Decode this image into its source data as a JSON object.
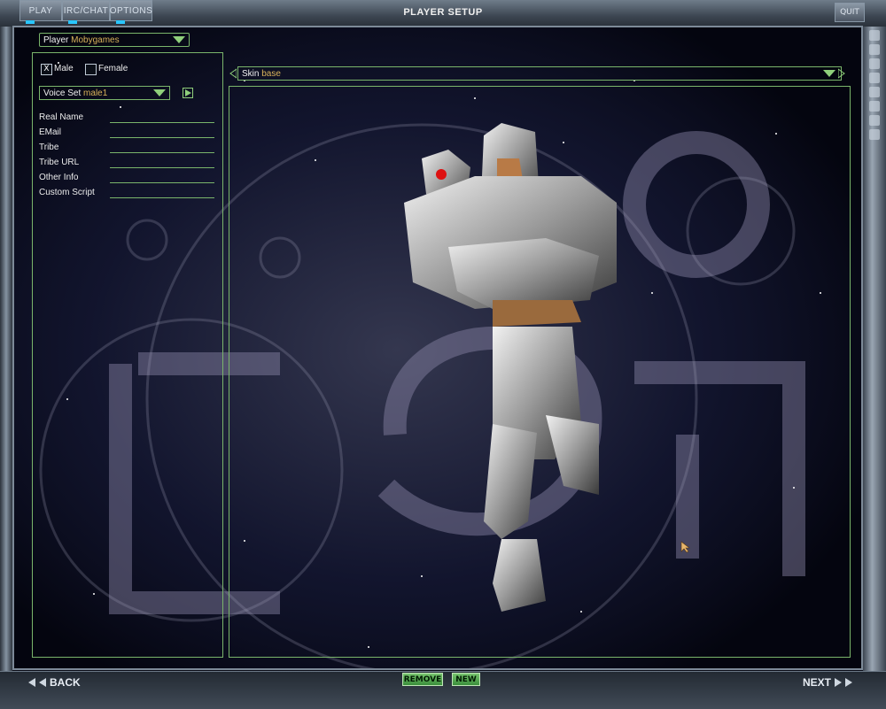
{
  "tabs": [
    {
      "label": "PLAY"
    },
    {
      "label": "IRC/CHAT"
    },
    {
      "label": "OPTIONS"
    }
  ],
  "title": "PLAYER SETUP",
  "quit_label": "QUIT",
  "player": {
    "label": "Player",
    "value": "Mobygames"
  },
  "gender": {
    "male": "Male",
    "female": "Female",
    "selected": "male",
    "male_check": "X"
  },
  "voice": {
    "label": "Voice Set",
    "value": "male1"
  },
  "fields": [
    {
      "label": "Real Name",
      "value": ""
    },
    {
      "label": "EMail",
      "value": ""
    },
    {
      "label": "Tribe",
      "value": ""
    },
    {
      "label": "Tribe URL",
      "value": ""
    },
    {
      "label": "Other Info",
      "value": ""
    },
    {
      "label": "Custom Script",
      "value": ""
    }
  ],
  "skin": {
    "label": "Skin",
    "value": "base"
  },
  "bottom": {
    "back": "BACK",
    "next": "NEXT",
    "remove": "REMOVE",
    "new": "NEW"
  },
  "colors": {
    "green": "#7ab56b",
    "accent": "#d9b25a",
    "led": "#2ac6ff"
  },
  "icons": {
    "voice_play": "play-icon",
    "mouse": "cursor-icon"
  }
}
